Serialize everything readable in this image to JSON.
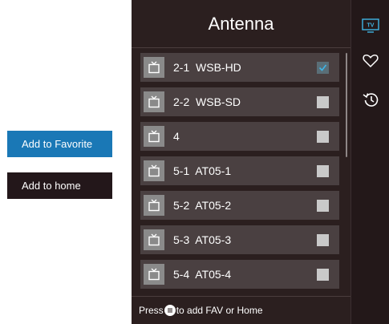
{
  "side_buttons": {
    "add_to_favorite": "Add to Favorite",
    "add_to_home": "Add to home"
  },
  "panel": {
    "title": "Antenna",
    "footer": {
      "before": "Press",
      "after": "to add FAV or Home",
      "button_icon": "menu-icon"
    }
  },
  "channels": [
    {
      "label": "2-1  WSB-HD",
      "checked": true,
      "icon": "tv-icon"
    },
    {
      "label": "2-2  WSB-SD",
      "checked": false,
      "icon": "tv-icon"
    },
    {
      "label": "4",
      "checked": false,
      "icon": "tv-icon"
    },
    {
      "label": "5-1  AT05-1",
      "checked": false,
      "icon": "tv-icon"
    },
    {
      "label": "5-2  AT05-2",
      "checked": false,
      "icon": "tv-icon"
    },
    {
      "label": "5-3  AT05-3",
      "checked": false,
      "icon": "tv-icon"
    },
    {
      "label": "5-4  AT05-4",
      "checked": false,
      "icon": "tv-icon"
    }
  ],
  "rail": [
    {
      "icon": "tv-icon",
      "text": "TV",
      "active": true
    },
    {
      "icon": "heart-icon",
      "active": false
    },
    {
      "icon": "history-icon",
      "active": false
    }
  ],
  "colors": {
    "accent": "#1a78b6",
    "panel_bg": "#2b1f1f",
    "row_bg": "#4a4041",
    "rail_active": "#3fb5e6"
  }
}
